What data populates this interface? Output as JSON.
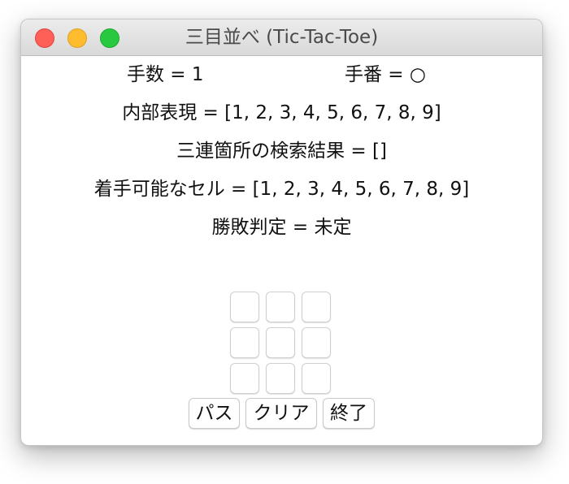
{
  "window": {
    "title": "三目並べ (Tic-Tac-Toe)"
  },
  "status": {
    "move_count": "手数 = 1",
    "current_player": "手番 = ○",
    "internal_repr": "内部表現 = [1, 2, 3, 4, 5, 6, 7, 8, 9]",
    "line_search": "三連箇所の検索結果 = []",
    "available_cells": "着手可能なセル = [1, 2, 3, 4, 5, 6, 7, 8, 9]",
    "verdict": "勝敗判定 = 未定"
  },
  "board": {
    "cells": [
      "",
      "",
      "",
      "",
      "",
      "",
      "",
      "",
      ""
    ]
  },
  "buttons": {
    "pass": "パス",
    "clear": "クリア",
    "quit": "終了"
  },
  "colors": {
    "close": "#fe5f57",
    "minimize": "#febc2e",
    "maximize": "#28c840"
  }
}
